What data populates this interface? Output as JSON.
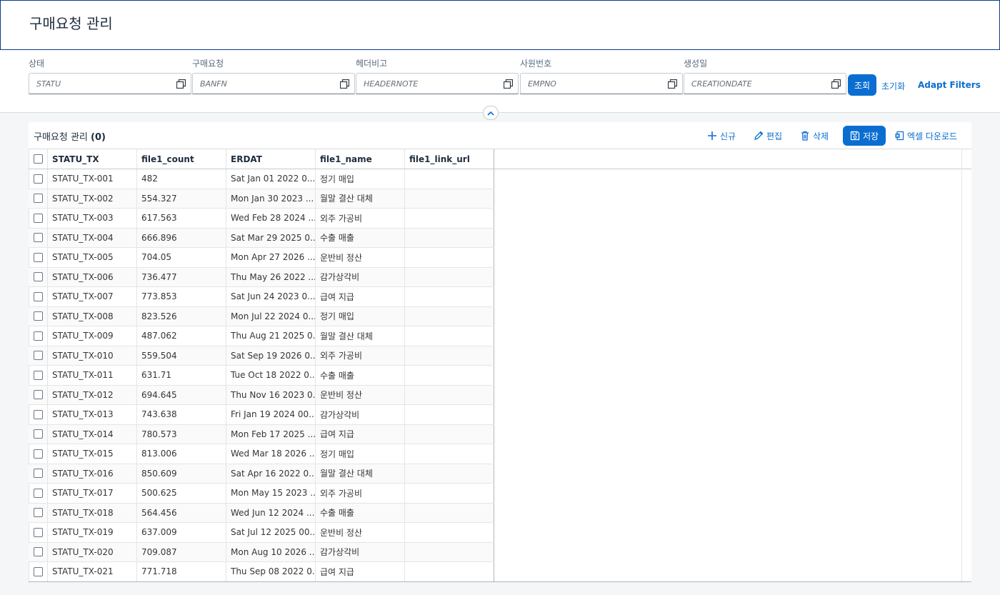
{
  "page": {
    "title": "구매요청 관리"
  },
  "filters": [
    {
      "label": "상태",
      "placeholder": "STATU"
    },
    {
      "label": "구매요청",
      "placeholder": "BANFN"
    },
    {
      "label": "헤더비고",
      "placeholder": "HEADERNOTE"
    },
    {
      "label": "사원번호",
      "placeholder": "EMPNO"
    },
    {
      "label": "생성일",
      "placeholder": "CREATIONDATE"
    }
  ],
  "filter_actions": {
    "search": "조회",
    "reset": "초기화",
    "adapt": "Adapt Filters"
  },
  "table": {
    "title": "구매요청 관리",
    "count": "(0)",
    "actions": {
      "new": "신규",
      "edit": "편집",
      "delete": "삭제",
      "save": "저장",
      "excel": "엑셀 다운로드"
    },
    "columns": [
      "STATU_TX",
      "file1_count",
      "ERDAT",
      "file1_name",
      "file1_link_url"
    ],
    "rows": [
      [
        "STATU_TX-001",
        "482",
        "Sat Jan 01 2022 0...",
        "정기 매입",
        ""
      ],
      [
        "STATU_TX-002",
        "554.327",
        "Mon Jan 30 2023 ...",
        "월말 결산 대체",
        ""
      ],
      [
        "STATU_TX-003",
        "617.563",
        "Wed Feb 28 2024 ...",
        "외주 가공비",
        ""
      ],
      [
        "STATU_TX-004",
        "666.896",
        "Sat Mar 29 2025 0...",
        "수출 매출",
        ""
      ],
      [
        "STATU_TX-005",
        "704.05",
        "Mon Apr 27 2026 ...",
        "운반비 정산",
        ""
      ],
      [
        "STATU_TX-006",
        "736.477",
        "Thu May 26 2022 ...",
        "감가상각비",
        ""
      ],
      [
        "STATU_TX-007",
        "773.853",
        "Sat Jun 24 2023 0...",
        "급여 지급",
        ""
      ],
      [
        "STATU_TX-008",
        "823.526",
        "Mon Jul 22 2024 0...",
        "정기 매입",
        ""
      ],
      [
        "STATU_TX-009",
        "487.062",
        "Thu Aug 21 2025 0...",
        "월말 결산 대체",
        ""
      ],
      [
        "STATU_TX-010",
        "559.504",
        "Sat Sep 19 2026 0...",
        "외주 가공비",
        ""
      ],
      [
        "STATU_TX-011",
        "631.71",
        "Tue Oct 18 2022 0...",
        "수출 매출",
        ""
      ],
      [
        "STATU_TX-012",
        "694.645",
        "Thu Nov 16 2023 0...",
        "운반비 정산",
        ""
      ],
      [
        "STATU_TX-013",
        "743.638",
        "Fri Jan 19 2024 00...",
        "감가상각비",
        ""
      ],
      [
        "STATU_TX-014",
        "780.573",
        "Mon Feb 17 2025 ...",
        "급여 지급",
        ""
      ],
      [
        "STATU_TX-015",
        "813.006",
        "Wed Mar 18 2026 ...",
        "정기 매입",
        ""
      ],
      [
        "STATU_TX-016",
        "850.609",
        "Sat Apr 16 2022 0...",
        "월말 결산 대체",
        ""
      ],
      [
        "STATU_TX-017",
        "500.625",
        "Mon May 15 2023 ...",
        "외주 가공비",
        ""
      ],
      [
        "STATU_TX-018",
        "564.456",
        "Wed Jun 12 2024 ...",
        "수출 매출",
        ""
      ],
      [
        "STATU_TX-019",
        "637.009",
        "Sat Jul 12 2025 00...",
        "운반비 정산",
        ""
      ],
      [
        "STATU_TX-020",
        "709.087",
        "Mon Aug 10 2026 ...",
        "감가상각비",
        ""
      ],
      [
        "STATU_TX-021",
        "771.718",
        "Thu Sep 08 2022 0...",
        "급여 지급",
        ""
      ]
    ]
  },
  "colors": {
    "accent": "#0a6ed1",
    "title_border": "#0a3b8c"
  }
}
